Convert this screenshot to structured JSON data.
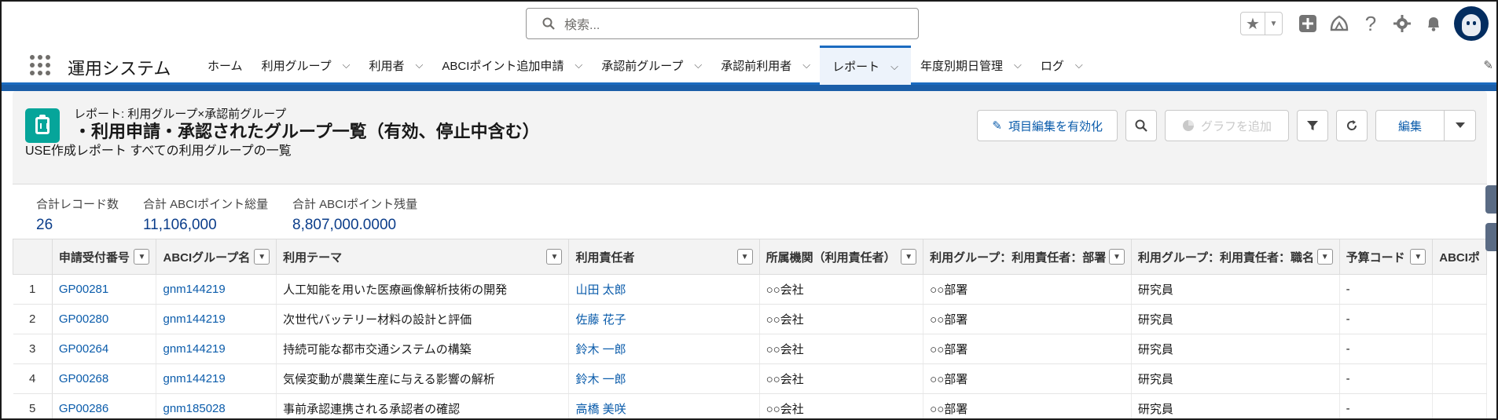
{
  "header": {
    "search_placeholder": "検索...",
    "utility_icons": [
      "star-icon",
      "add-icon",
      "trailhead-icon",
      "help-icon",
      "setup-gear-icon",
      "notification-bell-icon",
      "avatar"
    ]
  },
  "nav": {
    "app_name": "運用システム",
    "tabs": [
      {
        "label": "ホーム",
        "has_menu": false,
        "active": false
      },
      {
        "label": "利用グループ",
        "has_menu": true,
        "active": false
      },
      {
        "label": "利用者",
        "has_menu": true,
        "active": false
      },
      {
        "label": "ABCIポイント追加申請",
        "has_menu": true,
        "active": false
      },
      {
        "label": "承認前グループ",
        "has_menu": true,
        "active": false
      },
      {
        "label": "承認前利用者",
        "has_menu": true,
        "active": false
      },
      {
        "label": "レポート",
        "has_menu": true,
        "active": true
      },
      {
        "label": "年度別期日管理",
        "has_menu": true,
        "active": false
      },
      {
        "label": "ログ",
        "has_menu": true,
        "active": false
      }
    ]
  },
  "report": {
    "subtitle": "レポート: 利用グループ×承認前グループ",
    "title": "・利用申請・承認されたグループ一覧（有効、停止中含む）",
    "description": "USE作成レポート すべての利用グループの一覧",
    "buttons": {
      "enable_field_edit": "項目編集を有効化",
      "add_chart": "グラフを追加",
      "edit": "編集"
    }
  },
  "summary": [
    {
      "label": "合計レコード数",
      "value": "26"
    },
    {
      "label": "合計 ABCIポイント総量",
      "value": "11,106,000"
    },
    {
      "label": "合計 ABCIポイント残量",
      "value": "8,807,000.0000"
    }
  ],
  "table": {
    "columns": [
      "申請受付番号",
      "ABCIグループ名",
      "利用テーマ",
      "利用責任者",
      "所属機関（利用責任者）",
      "利用グループ：利用責任者：部署",
      "利用グループ：利用責任者：職名",
      "予算コード",
      "ABCIポ"
    ],
    "rows": [
      {
        "n": "1",
        "id": "GP00281",
        "group": "gnm144219",
        "theme": "人工知能を用いた医療画像解析技術の開発",
        "owner": "山田 太郎",
        "org": "○○会社",
        "dept": "○○部署",
        "title": "研究員",
        "budget": "-"
      },
      {
        "n": "2",
        "id": "GP00280",
        "group": "gnm144219",
        "theme": "次世代バッテリー材料の設計と評価",
        "owner": "佐藤 花子",
        "org": "○○会社",
        "dept": "○○部署",
        "title": "研究員",
        "budget": "-"
      },
      {
        "n": "3",
        "id": "GP00264",
        "group": "gnm144219",
        "theme": "持続可能な都市交通システムの構築",
        "owner": "鈴木 一郎",
        "org": "○○会社",
        "dept": "○○部署",
        "title": "研究員",
        "budget": "-"
      },
      {
        "n": "4",
        "id": "GP00268",
        "group": "gnm144219",
        "theme": "気候変動が農業生産に与える影響の解析",
        "owner": "鈴木 一郎",
        "org": "○○会社",
        "dept": "○○部署",
        "title": "研究員",
        "budget": "-"
      },
      {
        "n": "5",
        "id": "GP00286",
        "group": "gnm185028",
        "theme": "事前承認連携される承認者の確認",
        "owner": "高橋 美咲",
        "org": "○○会社",
        "dept": "○○部署",
        "title": "研究員",
        "budget": "-"
      }
    ]
  },
  "colors": {
    "brand_blue": "#1b6bc0",
    "report_icon": "#06a59a",
    "link": "#0b5cab"
  }
}
